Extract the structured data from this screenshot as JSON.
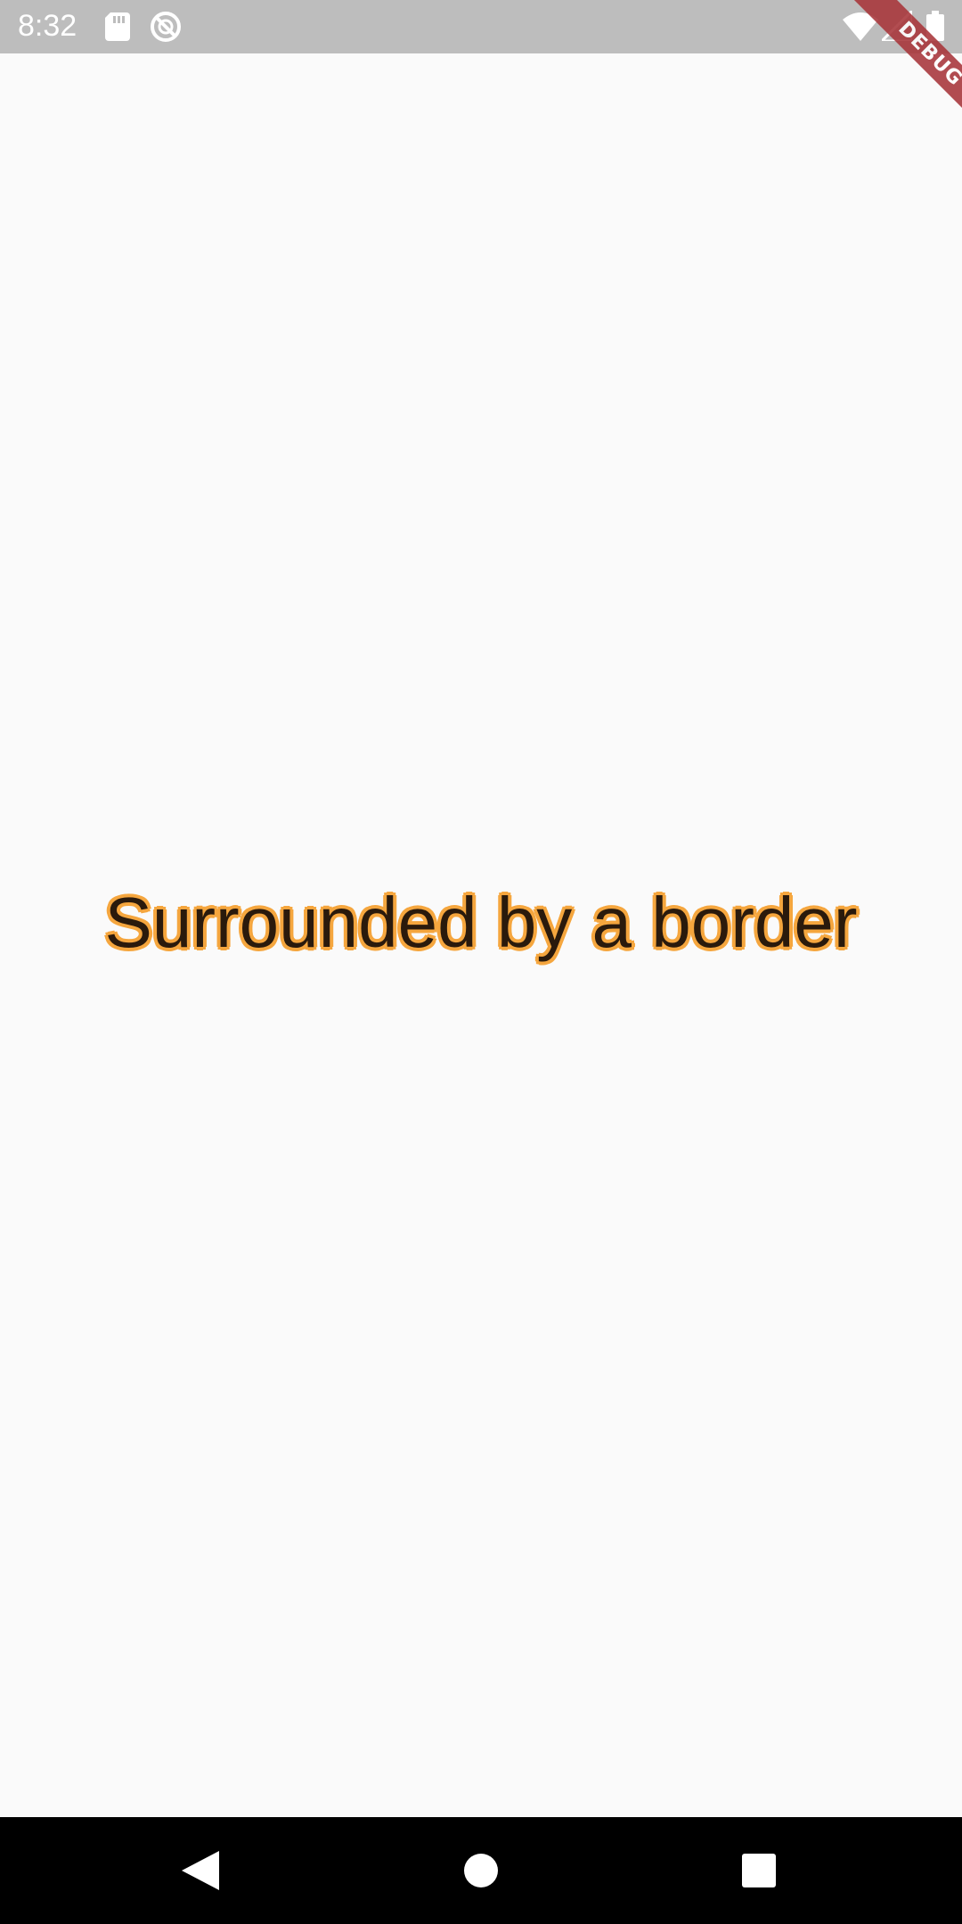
{
  "status_bar": {
    "time": "8:32",
    "icons": [
      "sd-card-icon",
      "sync-icon",
      "wifi-icon",
      "signal-icon",
      "battery-icon"
    ]
  },
  "debug_banner": {
    "label": "DEBUG",
    "color": "#a8353a"
  },
  "main": {
    "text": "Surrounded by a border",
    "text_color": "#2a1a0c",
    "border_color": "#f5a63e"
  },
  "nav_bar": {
    "buttons": [
      "back-icon",
      "home-icon",
      "recents-icon"
    ]
  }
}
